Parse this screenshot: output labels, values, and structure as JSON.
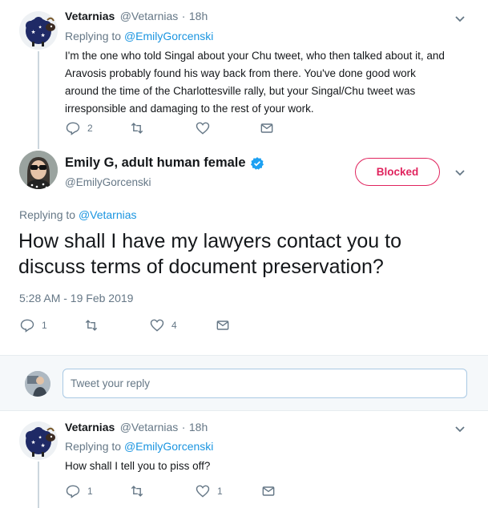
{
  "tweet1": {
    "author_name": "Vetarnias",
    "author_handle": "@Vetarnias",
    "separator": "·",
    "time": "18h",
    "replying_prefix": "Replying to",
    "replying_to": "@EmilyGorcenski",
    "lines": [
      "I'm the one who told Singal about your Chu tweet, who then talked about it, and",
      "Aravosis probably found his way back from there. You've done good work",
      "around the time of the Charlottesville rally, but your Singal/Chu tweet was",
      "irresponsible and damaging to the rest of your work."
    ],
    "reply_count": "2",
    "retweet_count": "",
    "like_count": ""
  },
  "focus": {
    "author_name": "Emily G, adult human female",
    "author_handle": "@EmilyGorcenski",
    "blocked_label": "Blocked",
    "replying_prefix": "Replying to",
    "replying_to": "@Vetarnias",
    "line1": "How shall I have my lawyers contact you to",
    "line2": "discuss terms of document preservation?",
    "timestamp": "5:28 AM - 19 Feb 2019",
    "reply_count": "1",
    "retweet_count": "",
    "like_count": "4"
  },
  "composer": {
    "placeholder": "Tweet your reply"
  },
  "tweet3": {
    "author_name": "Vetarnias",
    "author_handle": "@Vetarnias",
    "separator": "·",
    "time": "18h",
    "replying_prefix": "Replying to",
    "replying_to": "@EmilyGorcenski",
    "text": "How shall I tell you to piss off?",
    "reply_count": "1",
    "retweet_count": "",
    "like_count": "1"
  },
  "colors": {
    "accent": "#1da1f2",
    "link": "#1b95e0",
    "blocked": "#e0245e",
    "muted": "#657786",
    "composer_bg": "#f5f8fa"
  }
}
